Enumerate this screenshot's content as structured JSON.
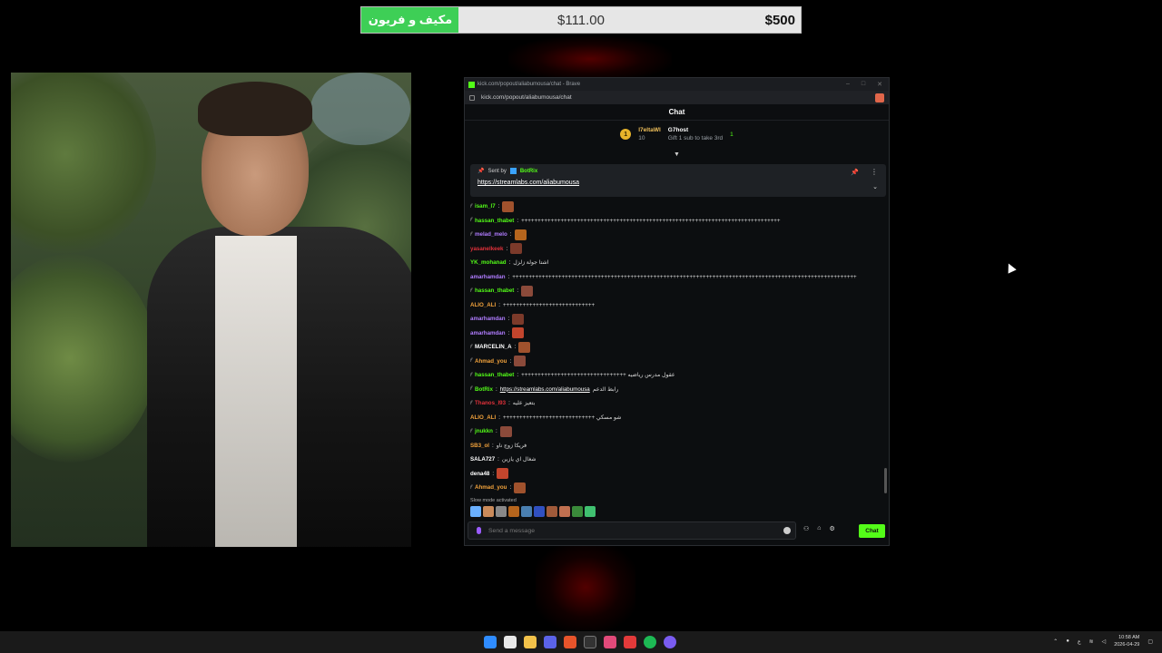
{
  "goal": {
    "title": "مكيف و فريون",
    "current": "$111.00",
    "target": "$500",
    "progress_fraction": 0.222
  },
  "browser": {
    "window_title": "kick.com/popout/aliabumousa/chat - Brave",
    "url": "kick.com/popout/aliabumousa/chat"
  },
  "chat": {
    "header": "Chat",
    "leaderboard": {
      "rank": "1",
      "top_user": "l7eltaWl",
      "top_count": "10",
      "host_name": "G7host",
      "host_count": "1",
      "gift_text": "Gift 1 sub to take 3rd"
    },
    "pinned": {
      "sent_by_label": "Sent by",
      "bot_name": "BotRix",
      "link": "https://streamlabs.com/aliabumousa"
    },
    "messages": [
      {
        "user": "isam_l7",
        "color": "#53fc18",
        "text": "",
        "emote": true,
        "badge": true
      },
      {
        "user": "hassan_thabet",
        "color": "#53fc18",
        "text": "+++++++++++++++++++++++++++++++++++++++++++++++++++++++++++++++++++++++++++++++",
        "emote": false,
        "badge": true
      },
      {
        "user": "melad_melo",
        "color": "#b07cff",
        "text": "",
        "emote": true,
        "badge": true
      },
      {
        "user": "yasanelkeek",
        "color": "#e0313a",
        "text": "",
        "emote": true,
        "badge": false
      },
      {
        "user": "YK_mohanad",
        "color": "#53fc18",
        "text": "اشتا جولة زلزل",
        "emote": false,
        "badge": false
      },
      {
        "user": "amarhamdan",
        "color": "#b07cff",
        "text": "+++++++++++++++++++++++++++++++++++++++++++++++++++++++++++++++++++++++++++++++++++++++++++++++++++++++++",
        "emote": false,
        "badge": false
      },
      {
        "user": "hassan_thabet",
        "color": "#53fc18",
        "text": "",
        "emote": true,
        "badge": true
      },
      {
        "user": "ALIO_ALI",
        "color": "#f3a33c",
        "text": "++++++++++++++++++++++++++++",
        "emote": false,
        "badge": false
      },
      {
        "user": "amarhamdan",
        "color": "#b07cff",
        "text": "",
        "emote": true,
        "badge": false
      },
      {
        "user": "amarhamdan",
        "color": "#b07cff",
        "text": "",
        "emote": true,
        "badge": false
      },
      {
        "user": "MARCELIN_A",
        "color": "#ffffff",
        "text": "",
        "emote": true,
        "badge": true
      },
      {
        "user": "Ahmad_you",
        "color": "#f3a33c",
        "text": "",
        "emote": true,
        "badge": true
      },
      {
        "user": "hassan_thabet",
        "color": "#53fc18",
        "text": "++++++++++++++++++++++++++++++++ عقول مدرس رياضيه",
        "emote": false,
        "badge": true
      },
      {
        "user": "BotRix",
        "color": "#53fc18",
        "text": "",
        "link": "https://streamlabs.com/aliabumousa",
        "link_after": "رابط الدعم",
        "emote": false,
        "badge": true
      },
      {
        "user": "Thanos_l93",
        "color": "#e0313a",
        "text": "بتعيز عليه",
        "emote": false,
        "badge": true
      },
      {
        "user": "ALIO_ALI",
        "color": "#f3a33c",
        "text": "++++++++++++++++++++++++++++ شو مسكي",
        "emote": false,
        "badge": false
      },
      {
        "user": "jnukkn",
        "color": "#53fc18",
        "text": "",
        "emote": true,
        "badge": true
      },
      {
        "user": "SB3_ol",
        "color": "#f3a33c",
        "text": "فريكا زوج ناو",
        "emote": false,
        "badge": false
      },
      {
        "user": "SALA727",
        "color": "#ffffff",
        "text": "شغال اي يازين",
        "emote": false,
        "badge": false
      },
      {
        "user": "dena48",
        "color": "#ffffff",
        "text": "",
        "emote": true,
        "badge": false
      },
      {
        "user": "Ahmad_you",
        "color": "#f3a33c",
        "text": "",
        "emote": true,
        "badge": true
      }
    ],
    "slow_mode": "Slow mode activated",
    "input_placeholder": "Send a message",
    "send_label": "Chat"
  },
  "taskbar": {
    "language": "ع",
    "time": "10:58 AM",
    "date": "2026-04-29"
  }
}
